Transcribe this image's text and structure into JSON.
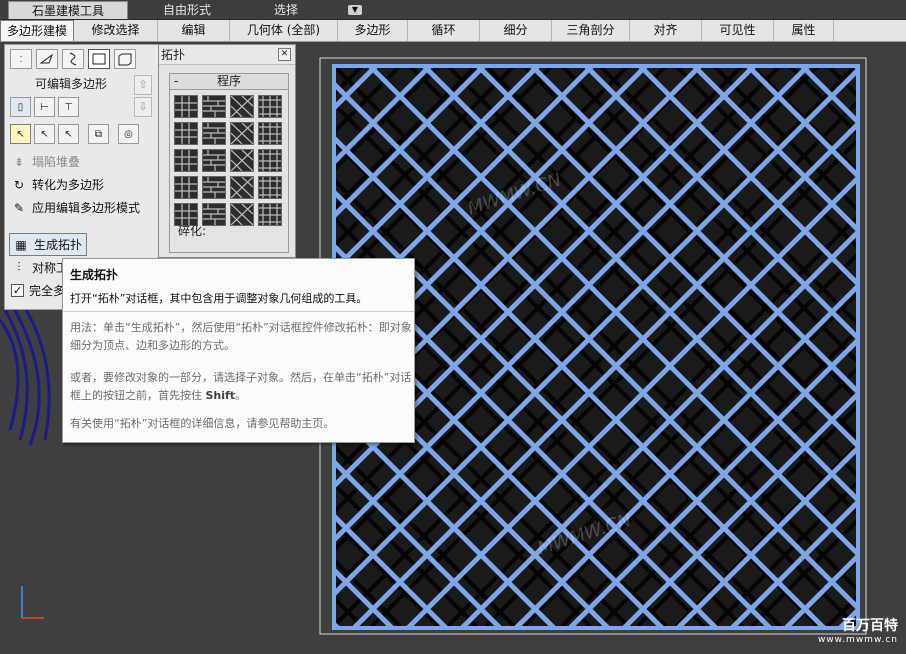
{
  "top_tabs": [
    {
      "label": "石墨建模工具",
      "active": true
    },
    {
      "label": "自由形式",
      "active": false
    },
    {
      "label": "选择",
      "active": false
    }
  ],
  "sub_tabs": [
    {
      "label": "多边形建模",
      "active": true,
      "w": 74
    },
    {
      "label": "修改选择",
      "active": false,
      "w": 84
    },
    {
      "label": "编辑",
      "active": false,
      "w": 72
    },
    {
      "label": "几何体 (全部)",
      "active": false,
      "w": 108
    },
    {
      "label": "多边形",
      "active": false,
      "w": 70
    },
    {
      "label": "循环",
      "active": false,
      "w": 72
    },
    {
      "label": "细分",
      "active": false,
      "w": 72
    },
    {
      "label": "三角剖分",
      "active": false,
      "w": 78
    },
    {
      "label": "对齐",
      "active": false,
      "w": 72
    },
    {
      "label": "可见性",
      "active": false,
      "w": 72
    },
    {
      "label": "属性",
      "active": false,
      "w": 60
    }
  ],
  "panel": {
    "editable_poly_label": "可编辑多边形",
    "collapse_stack": "塌陷堆叠",
    "convert_to_poly": "转化为多边形",
    "apply_edit_poly": "应用编辑多边形模式",
    "generate_topology": "生成拓扑",
    "symmetry_tools": "对称工",
    "full_mode": "完全多"
  },
  "topology_dialog": {
    "title": "拓扑",
    "group_label": "程序",
    "fracture_label": "碎化:"
  },
  "tooltip": {
    "title": "生成拓扑",
    "subtitle": "打开“拓朴”对话框，其中包含用于调整对象几何组成的工具。",
    "para1": "用法：单击“生成拓朴”，然后使用“拓朴”对话框控件修改拓朴：即对象细分为顶点、边和多边形的方式。",
    "para2_a": "或者，要修改对象的一部分，请选择子对象。然后，在单击“拓朴”对话框上的按钮之前，首先按住 ",
    "para2_key": "Shift",
    "para2_b": "。",
    "para3": "有关使用“拓朴”对话框的详细信息，请参见帮助主页。"
  },
  "watermarks": {
    "text": "MWMW.CN",
    "logo_main": "百万百特",
    "logo_sub": "www.mwmw.cn"
  },
  "colors": {
    "wire_blue": "#7ea6e8",
    "wire_black": "#050505",
    "panel_bg": "#e9e9e9"
  }
}
